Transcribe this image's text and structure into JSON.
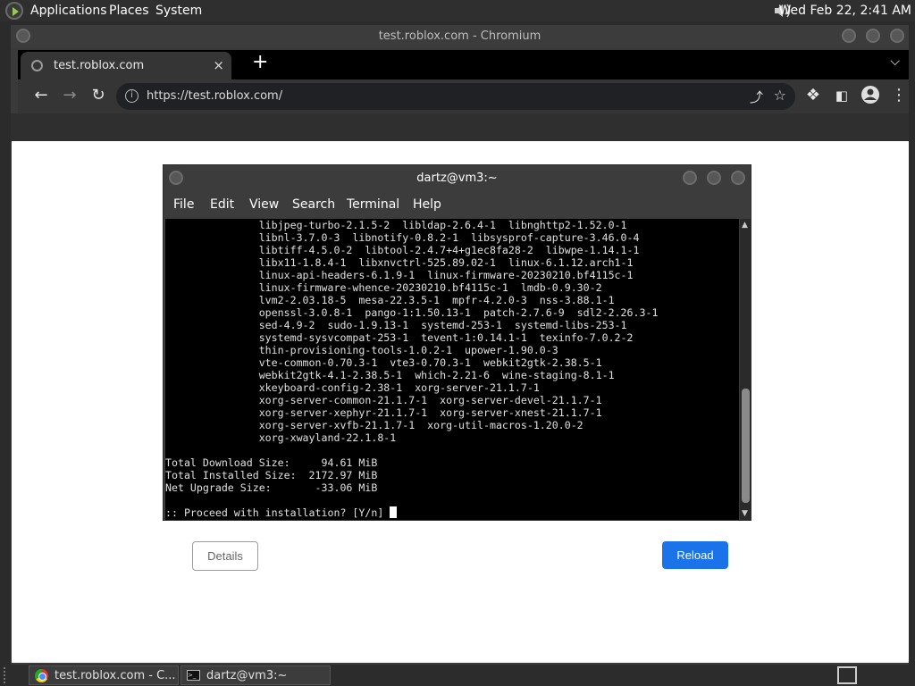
{
  "panel": {
    "menus": [
      "Applications",
      "Places",
      "System"
    ],
    "clock": "Wed Feb 22,  2:41 AM"
  },
  "browser": {
    "window_title": "test.roblox.com - Chromium",
    "tab_title": "test.roblox.com",
    "tab_close": "×",
    "new_tab": "+",
    "url": "https://test.roblox.com/",
    "details_label": "Details",
    "reload_label": "Reload"
  },
  "terminal": {
    "title": "dartz@vm3:~",
    "menu": [
      "File",
      "Edit",
      "View",
      "Search",
      "Terminal",
      "Help"
    ],
    "lines": [
      "               libjpeg-turbo-2.1.5-2  libldap-2.6.4-1  libnghttp2-1.52.0-1",
      "               libnl-3.7.0-3  libnotify-0.8.2-1  libsysprof-capture-3.46.0-4",
      "               libtiff-4.5.0-2  libtool-2.4.7+4+g1ec8fa28-2  libwpe-1.14.1-1",
      "               libx11-1.8.4-1  libxnvctrl-525.89.02-1  linux-6.1.12.arch1-1",
      "               linux-api-headers-6.1.9-1  linux-firmware-20230210.bf4115c-1",
      "               linux-firmware-whence-20230210.bf4115c-1  lmdb-0.9.30-2",
      "               lvm2-2.03.18-5  mesa-22.3.5-1  mpfr-4.2.0-3  nss-3.88.1-1",
      "               openssl-3.0.8-1  pango-1:1.50.13-1  patch-2.7.6-9  sdl2-2.26.3-1",
      "               sed-4.9-2  sudo-1.9.13-1  systemd-253-1  systemd-libs-253-1",
      "               systemd-sysvcompat-253-1  tevent-1:0.14.1-1  texinfo-7.0.2-2",
      "               thin-provisioning-tools-1.0.2-1  upower-1.90.0-3",
      "               vte-common-0.70.3-1  vte3-0.70.3-1  webkit2gtk-2.38.5-1",
      "               webkit2gtk-4.1-2.38.5-1  which-2.21-6  wine-staging-8.1-1",
      "               xkeyboard-config-2.38-1  xorg-server-21.1.7-1",
      "               xorg-server-common-21.1.7-1  xorg-server-devel-21.1.7-1",
      "               xorg-server-xephyr-21.1.7-1  xorg-server-xnest-21.1.7-1",
      "               xorg-server-xvfb-21.1.7-1  xorg-util-macros-1.20.0-2",
      "               xorg-xwayland-22.1.8-1",
      "",
      "Total Download Size:     94.61 MiB",
      "Total Installed Size:  2172.97 MiB",
      "Net Upgrade Size:       -33.06 MiB",
      ""
    ],
    "prompt": ":: Proceed with installation? [Y/n] "
  },
  "taskbar": {
    "items": [
      "test.roblox.com - C...",
      "dartz@vm3:~"
    ]
  }
}
